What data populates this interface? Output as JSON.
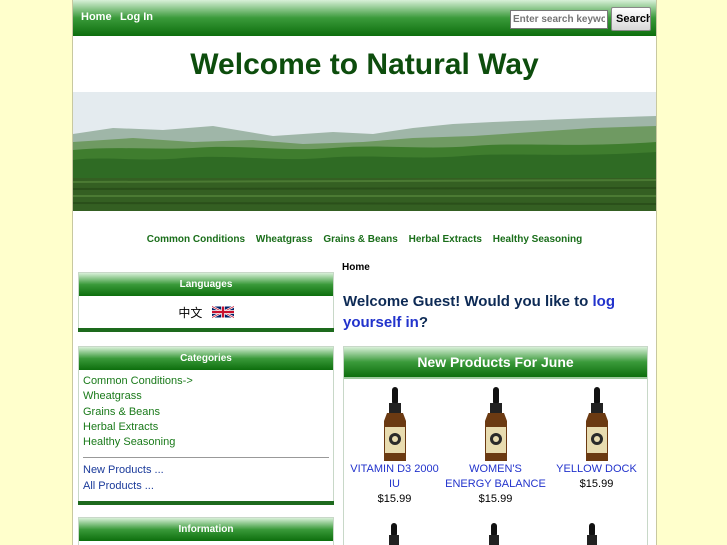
{
  "nav": {
    "home": "Home",
    "login": "Log In"
  },
  "search": {
    "placeholder": "Enter search keywords here",
    "button": "Search"
  },
  "site_title": "Welcome to Natural Way",
  "category_nav": [
    "Common Conditions",
    "Wheatgrass",
    "Grains & Beans",
    "Herbal Extracts",
    "Healthy Seasoning"
  ],
  "languages": {
    "heading": "Languages",
    "chinese": "中文"
  },
  "categories": {
    "heading": "Categories",
    "items": [
      "Common Conditions->",
      "Wheatgrass",
      "Grains & Beans",
      "Herbal Extracts",
      "Healthy Seasoning"
    ],
    "more": [
      "New Products ...",
      "All Products ..."
    ]
  },
  "information": {
    "heading": "Information"
  },
  "breadcrumb": "Home",
  "welcome": {
    "text": "Welcome Guest! Would you like to ",
    "link": "log yourself in",
    "suffix": "?"
  },
  "new_products": {
    "heading": "New Products For June",
    "items": [
      {
        "name": "VITAMIN D3 2000 IU",
        "price": "$15.99"
      },
      {
        "name": "WOMEN'S ENERGY BALANCE",
        "price": "$15.99"
      },
      {
        "name": "YELLOW DOCK",
        "price": "$15.99"
      }
    ]
  },
  "colors": {
    "page_bg": "#ffffcc",
    "title_green": "#0d4d0d",
    "link_green": "#1a6e1a",
    "link_blue": "#2233cc",
    "bar_green": "#0d6e0d"
  }
}
